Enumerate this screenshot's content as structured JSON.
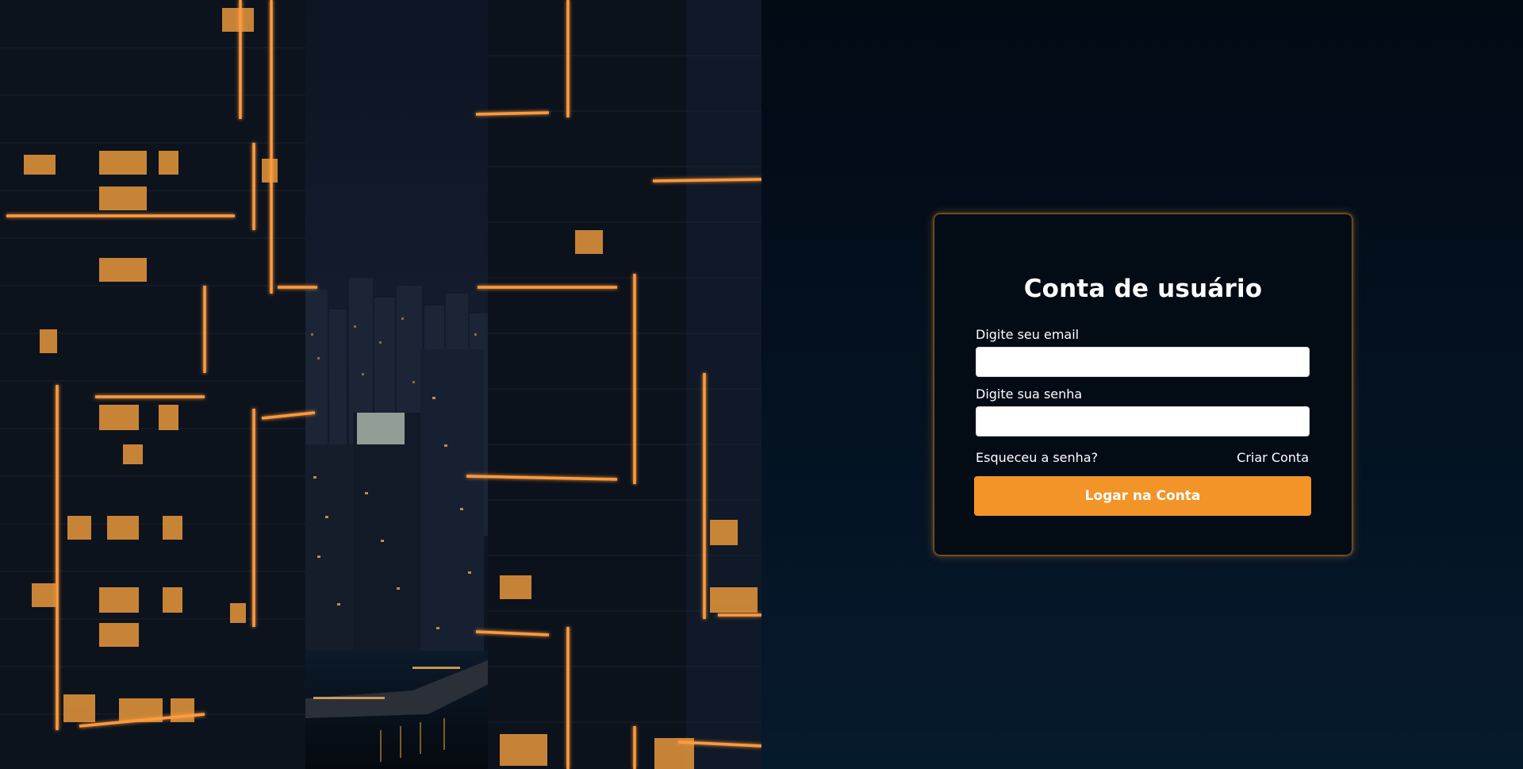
{
  "hero": {
    "image_description_icon": "city-night-photo-icon"
  },
  "login": {
    "title": "Conta de usuário",
    "email_label": "Digite seu email",
    "email_value": "",
    "password_label": "Digite sua senha",
    "password_value": "",
    "forgot_link": "Esqueceu a senha?",
    "create_link": "Criar Conta",
    "submit_label": "Logar na Conta"
  },
  "colors": {
    "accent": "#f29428",
    "background": "#05101d",
    "card": "#030b15"
  }
}
